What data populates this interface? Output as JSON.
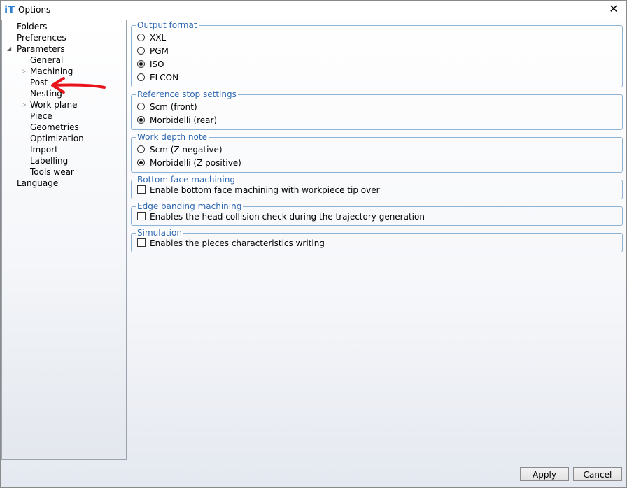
{
  "window": {
    "title": "Options",
    "app_icon": "iT",
    "close_glyph": "✕"
  },
  "tree": {
    "items": [
      {
        "label": "Folders"
      },
      {
        "label": "Preferences"
      },
      {
        "label": "Parameters",
        "expander": "◢"
      },
      {
        "label": "General"
      },
      {
        "label": "Machining",
        "expander": "▷"
      },
      {
        "label": "Post"
      },
      {
        "label": "Nesting"
      },
      {
        "label": "Work plane",
        "expander": "▷"
      },
      {
        "label": "Piece"
      },
      {
        "label": "Geometries"
      },
      {
        "label": "Optimization"
      },
      {
        "label": "Import"
      },
      {
        "label": "Labelling"
      },
      {
        "label": "Tools wear"
      },
      {
        "label": "Language"
      }
    ]
  },
  "groups": {
    "output_format": {
      "legend": "Output format",
      "options": [
        {
          "label": "XXL",
          "checked": false
        },
        {
          "label": "PGM",
          "checked": false
        },
        {
          "label": "ISO",
          "checked": true
        },
        {
          "label": "ELCON",
          "checked": false
        }
      ]
    },
    "reference_stop": {
      "legend": "Reference stop settings",
      "options": [
        {
          "label": "Scm (front)",
          "checked": false
        },
        {
          "label": "Morbidelli (rear)",
          "checked": true
        }
      ]
    },
    "work_depth": {
      "legend": "Work depth note",
      "options": [
        {
          "label": "Scm (Z negative)",
          "checked": false
        },
        {
          "label": "Morbidelli (Z positive)",
          "checked": true
        }
      ]
    },
    "bottom_face": {
      "legend": "Bottom face machining",
      "checkbox": {
        "label": "Enable bottom face machining with workpiece tip over",
        "checked": false
      }
    },
    "edge_banding": {
      "legend": "Edge banding machining",
      "checkbox": {
        "label": "Enables the head collision check during the trajectory generation",
        "checked": false
      }
    },
    "simulation": {
      "legend": "Simulation",
      "checkbox": {
        "label": "Enables the pieces characteristics writing",
        "checked": false
      }
    }
  },
  "buttons": {
    "apply": "Apply",
    "cancel": "Cancel"
  },
  "colors": {
    "annotation_arrow": "#e8141b",
    "legend_text": "#2e67b1",
    "group_border": "#8fb3d6"
  }
}
